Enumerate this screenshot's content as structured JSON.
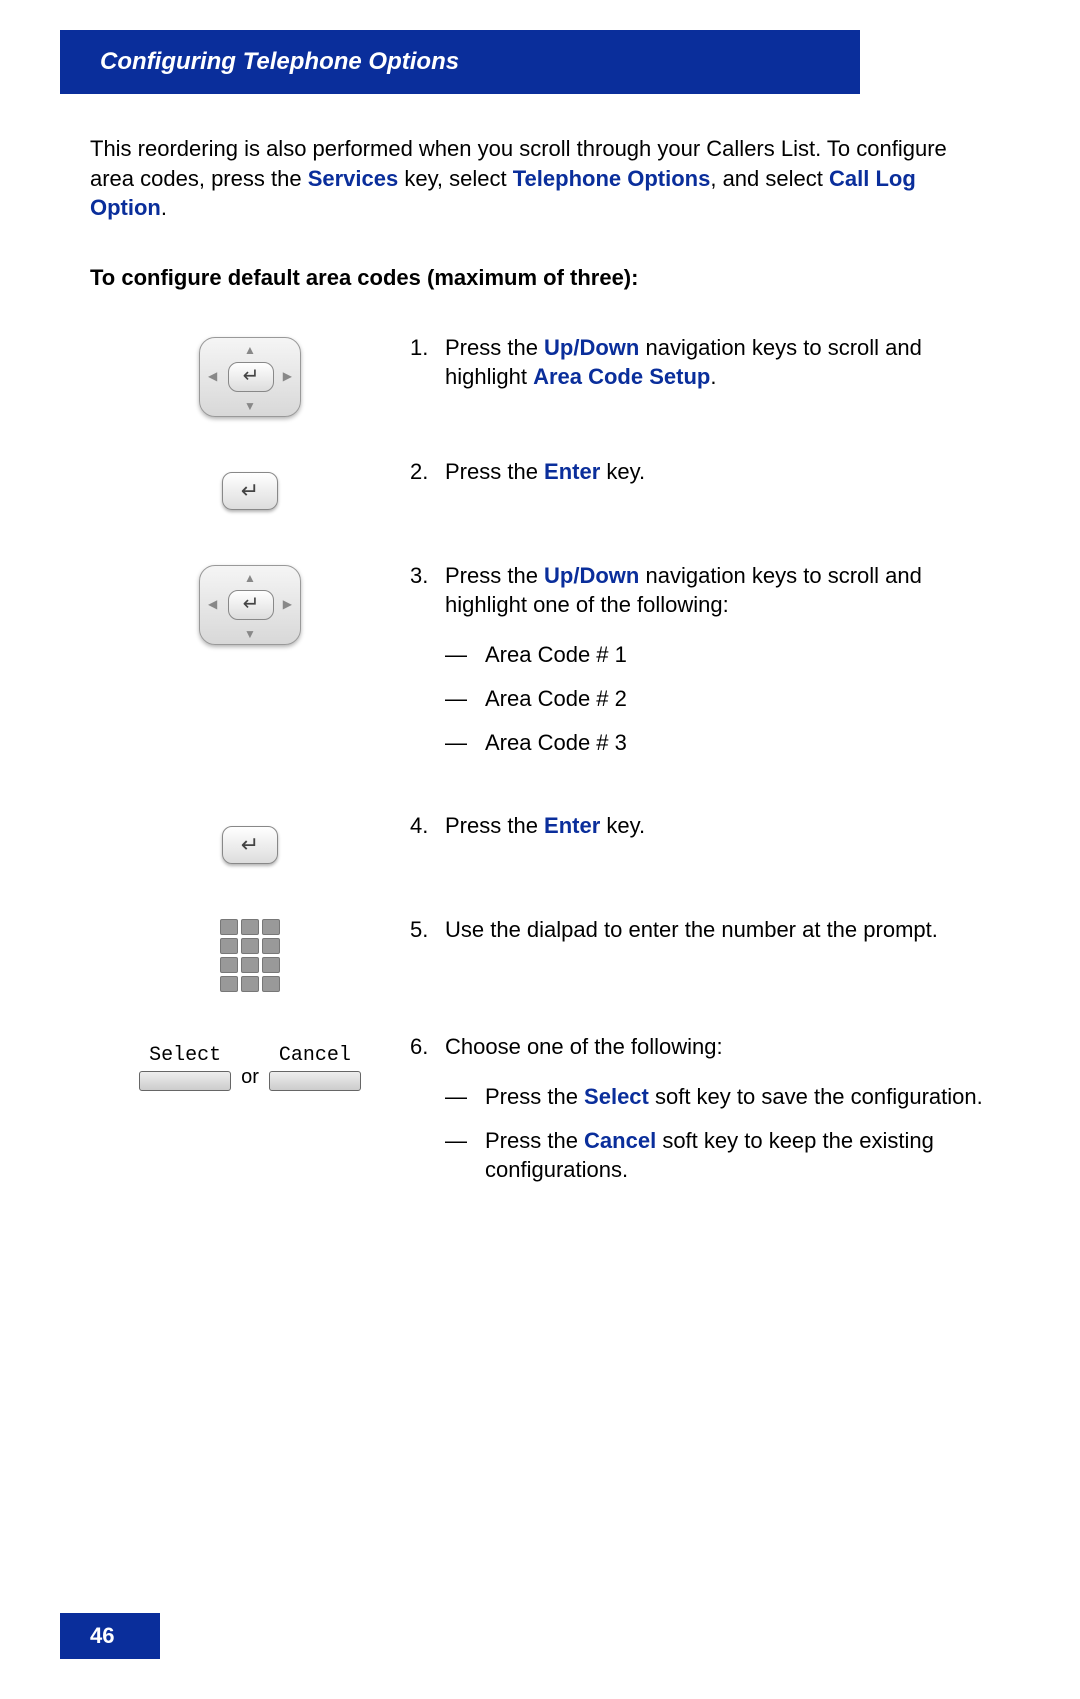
{
  "header": "Configuring Telephone Options",
  "intro": {
    "t1": "This reordering is also performed when you scroll through your Callers List. To configure area codes, press the ",
    "link1": "Services",
    "t2": " key, select ",
    "link2": "Telephone Options",
    "t3": ", and select ",
    "link3": "Call Log Option",
    "t4": "."
  },
  "section_head": "To configure default area codes (maximum of three):",
  "steps": {
    "s1": {
      "num": "1.",
      "a": "Press the ",
      "link1": "Up/Down",
      "b": " navigation keys to scroll and highlight ",
      "link2": "Area Code Setup",
      "c": "."
    },
    "s2": {
      "num": "2.",
      "a": "Press the ",
      "link1": "Enter",
      "b": " key."
    },
    "s3": {
      "num": "3.",
      "a": "Press the ",
      "link1": "Up/Down",
      "b": " navigation keys to scroll and highlight one of the following:",
      "opt1": "Area Code # 1",
      "opt2": "Area Code # 2",
      "opt3": "Area Code # 3"
    },
    "s4": {
      "num": "4.",
      "a": "Press the ",
      "link1": "Enter",
      "b": " key."
    },
    "s5": {
      "num": "5.",
      "a": "Use the dialpad to enter the number at the prompt."
    },
    "s6": {
      "num": "6.",
      "a": "Choose one of the following:",
      "o1a": "Press the ",
      "o1link": "Select",
      "o1b": " soft key to save the configuration.",
      "o2a": "Press the ",
      "o2link": "Cancel",
      "o2b": " soft key to keep the existing configurations."
    }
  },
  "softkeys": {
    "select": "Select",
    "or": "or",
    "cancel": "Cancel"
  },
  "dash": "—",
  "enter_glyph": "↵",
  "page_number": "46"
}
